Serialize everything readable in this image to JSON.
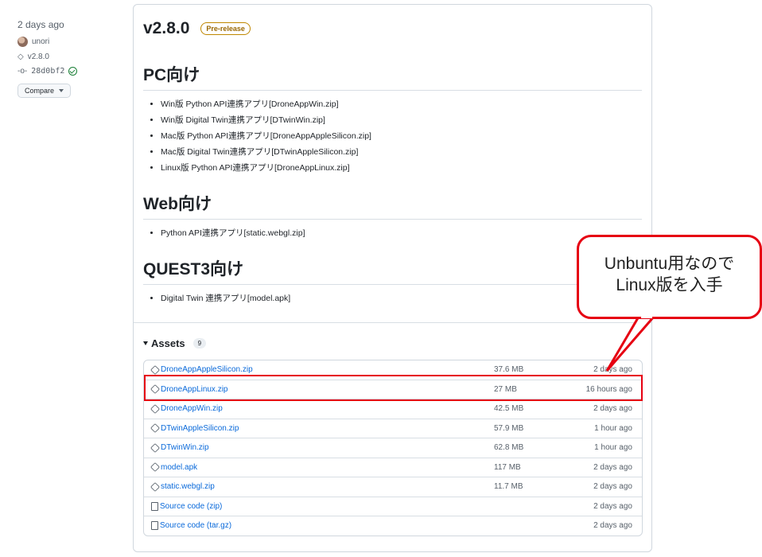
{
  "meta": {
    "date": "2 days ago",
    "author": "unori",
    "tag": "v2.8.0",
    "commit": "28d0bf2",
    "compare_label": "Compare"
  },
  "release": {
    "version": "v2.8.0",
    "badge": "Pre-release",
    "sections": [
      {
        "heading": "PC向け",
        "items": [
          "Win版 Python API連携アプリ[DroneAppWin.zip]",
          "Win版 Digital Twin連携アプリ[DTwinWin.zip]",
          "Mac版 Python API連携アプリ[DroneAppAppleSilicon.zip]",
          "Mac版 Digital Twin連携アプリ[DTwinAppleSilicon.zip]",
          "Linux版 Python API連携アプリ[DroneAppLinux.zip]"
        ]
      },
      {
        "heading": "Web向け",
        "items": [
          "Python API連携アプリ[static.webgl.zip]"
        ]
      },
      {
        "heading": "QUEST3向け",
        "items": [
          "Digital Twin 連携アプリ[model.apk]"
        ]
      }
    ]
  },
  "assets": {
    "label": "Assets",
    "count": "9",
    "rows": [
      {
        "name": "DroneAppAppleSilicon.zip",
        "size": "37.6 MB",
        "time": "2 days ago",
        "icon": "package-icon"
      },
      {
        "name": "DroneAppLinux.zip",
        "size": "27 MB",
        "time": "16 hours ago",
        "icon": "package-icon"
      },
      {
        "name": "DroneAppWin.zip",
        "size": "42.5 MB",
        "time": "2 days ago",
        "icon": "package-icon"
      },
      {
        "name": "DTwinAppleSilicon.zip",
        "size": "57.9 MB",
        "time": "1 hour ago",
        "icon": "package-icon"
      },
      {
        "name": "DTwinWin.zip",
        "size": "62.8 MB",
        "time": "1 hour ago",
        "icon": "package-icon"
      },
      {
        "name": "model.apk",
        "size": "117 MB",
        "time": "2 days ago",
        "icon": "package-icon"
      },
      {
        "name": "static.webgl.zip",
        "size": "11.7 MB",
        "time": "2 days ago",
        "icon": "package-icon"
      },
      {
        "name": "Source code (zip)",
        "size": "",
        "time": "2 days ago",
        "icon": "file-zip-icon"
      },
      {
        "name": "Source code (tar.gz)",
        "size": "",
        "time": "2 days ago",
        "icon": "file-zip-icon"
      }
    ]
  },
  "annotation": {
    "line1": "Unbuntu用なので",
    "line2": "Linux版を入手",
    "color": "#e60012"
  }
}
